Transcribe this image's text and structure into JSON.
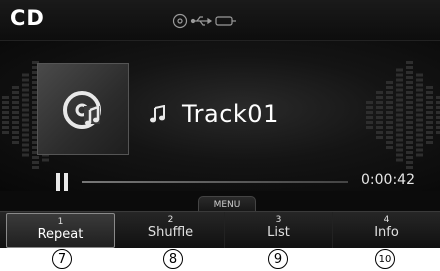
{
  "header": {
    "title": "CD",
    "source_icons": [
      "disc-icon",
      "usb-icon",
      "aux-icon"
    ]
  },
  "now_playing": {
    "album_art_icon": "cd-music-icon",
    "note_icon": "music-note-icon",
    "track": "Track01",
    "state_icon": "pause-icon",
    "elapsed": "0:00:42",
    "progress": 0.0
  },
  "menu_tab": {
    "label": "MENU"
  },
  "soft_buttons": [
    {
      "number": "1",
      "label": "Repeat",
      "active": true
    },
    {
      "number": "2",
      "label": "Shuffle",
      "active": false
    },
    {
      "number": "3",
      "label": "List",
      "active": false
    },
    {
      "number": "4",
      "label": "Info",
      "active": false
    }
  ],
  "callouts": [
    "7",
    "8",
    "9",
    "10"
  ],
  "colors": {
    "screen_bg": "#0b0b0b",
    "text": "#ffffff",
    "button_border": "#8a8a8a"
  }
}
